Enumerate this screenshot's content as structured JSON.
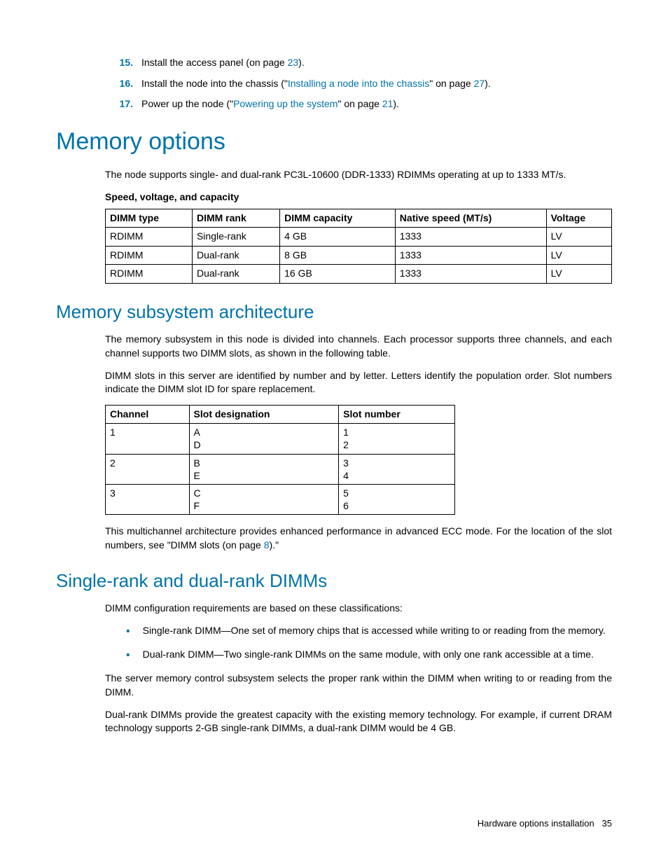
{
  "steps": [
    {
      "num": "15.",
      "prefix": "Install the access panel (on page ",
      "link": "23",
      "suffix": ")."
    },
    {
      "num": "16.",
      "prefix": "Install the node into the chassis (\"",
      "link1": "Installing a node into the chassis",
      "mid": "\" on page ",
      "link2": "27",
      "suffix": ")."
    },
    {
      "num": "17.",
      "prefix": "Power up the node (\"",
      "link1": "Powering up the system",
      "mid": "\" on page ",
      "link2": "21",
      "suffix": ")."
    }
  ],
  "h1": "Memory options",
  "intro": "The node supports single- and dual-rank PC3L-10600 (DDR-1333) RDIMMs operating at up to 1333 MT/s.",
  "table1_caption": "Speed, voltage, and capacity",
  "table1": {
    "headers": [
      "DIMM type",
      "DIMM rank",
      "DIMM capacity",
      "Native speed (MT/s)",
      "Voltage"
    ],
    "rows": [
      [
        "RDIMM",
        "Single-rank",
        "4 GB",
        "1333",
        "LV"
      ],
      [
        "RDIMM",
        "Dual-rank",
        "8 GB",
        "1333",
        "LV"
      ],
      [
        "RDIMM",
        "Dual-rank",
        "16 GB",
        "1333",
        "LV"
      ]
    ]
  },
  "h2a": "Memory subsystem architecture",
  "arch_p1": "The memory subsystem in this node is divided into channels. Each processor supports three channels, and each channel supports two DIMM slots, as shown in the following table.",
  "arch_p2": "DIMM slots in this server are identified by number and by letter. Letters identify the population order. Slot numbers indicate the DIMM slot ID for spare replacement.",
  "table2": {
    "headers": [
      "Channel",
      "Slot designation",
      "Slot number"
    ],
    "rows": [
      {
        "channel": "1",
        "desig": [
          "A",
          "D"
        ],
        "slot": [
          "1",
          "2"
        ]
      },
      {
        "channel": "2",
        "desig": [
          "B",
          "E"
        ],
        "slot": [
          "3",
          "4"
        ]
      },
      {
        "channel": "3",
        "desig": [
          "C",
          "F"
        ],
        "slot": [
          "5",
          "6"
        ]
      }
    ]
  },
  "arch_p3_prefix": "This multichannel architecture provides enhanced performance in advanced ECC mode. For the location of the slot numbers, see \"DIMM slots (on page ",
  "arch_p3_link": "8",
  "arch_p3_suffix": ").\"",
  "h2b": "Single-rank and dual-rank DIMMs",
  "rank_p1": "DIMM configuration requirements are based on these classifications:",
  "rank_bullets": [
    "Single-rank DIMM—One set of memory chips that is accessed while writing to or reading from the memory.",
    "Dual-rank DIMM—Two single-rank DIMMs on the same module, with only one rank accessible at a time."
  ],
  "rank_p2": "The server memory control subsystem selects the proper rank within the DIMM when writing to or reading from the DIMM.",
  "rank_p3": "Dual-rank DIMMs provide the greatest capacity with the existing memory technology. For example, if current DRAM technology supports 2-GB single-rank DIMMs, a dual-rank DIMM would be 4 GB.",
  "footer_text": "Hardware options installation",
  "footer_page": "35"
}
